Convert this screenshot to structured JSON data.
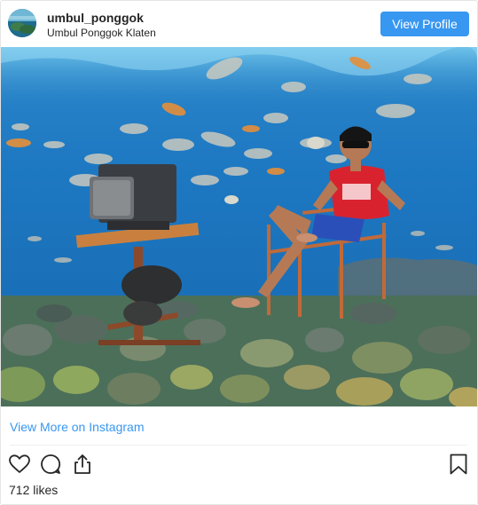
{
  "header": {
    "username": "umbul_ponggok",
    "location": "Umbul Ponggok Klaten",
    "view_profile_label": "View Profile"
  },
  "post": {
    "image_alt": "Underwater photo of a man in sunglasses and red shirt seated on a chair on a rocky riverbed beside a table with an old television, surrounded by fish",
    "view_more_label": "View More on Instagram",
    "likes_text": "712 likes"
  },
  "icons": {
    "like": "heart-icon",
    "comment": "comment-bubble-icon",
    "share": "share-upload-icon",
    "save": "bookmark-icon"
  },
  "colors": {
    "accent": "#3897f0",
    "text": "#262626",
    "border": "#e6e6e6"
  }
}
